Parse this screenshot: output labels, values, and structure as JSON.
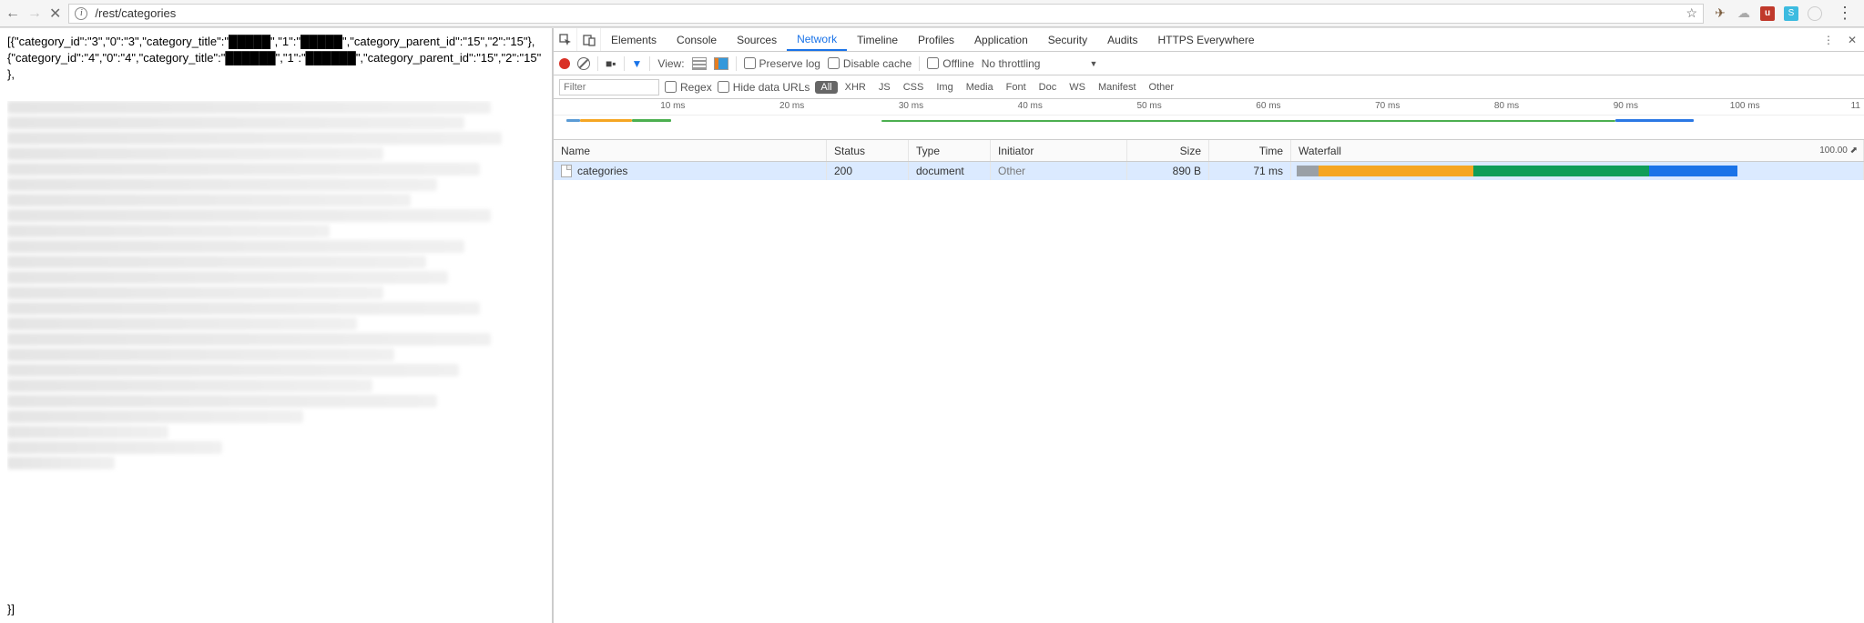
{
  "address_url": "/rest/categories",
  "json_lines": [
    "[{\"category_id\":\"3\",\"0\":\"3\",\"category_title\":\"█████\",\"1\":\"█████\",\"category_parent_id\":\"15\",\"2\":\"15\"},",
    "{\"category_id\":\"4\",\"0\":\"4\",\"category_title\":\"██████\",\"1\":\"██████\",\"category_parent_id\":\"15\",\"2\":\"15\"",
    "},"
  ],
  "json_tail": "}]",
  "devtools_tabs": [
    "Elements",
    "Console",
    "Sources",
    "Network",
    "Timeline",
    "Profiles",
    "Application",
    "Security",
    "Audits",
    "HTTPS Everywhere"
  ],
  "active_tab": "Network",
  "toolbar": {
    "view_label": "View:",
    "preserve_log": "Preserve log",
    "disable_cache": "Disable cache",
    "offline": "Offline",
    "no_throttling": "No throttling"
  },
  "filter_row": {
    "placeholder": "Filter",
    "regex": "Regex",
    "hide_data_urls": "Hide data URLs",
    "types": [
      "All",
      "XHR",
      "JS",
      "CSS",
      "Img",
      "Media",
      "Font",
      "Doc",
      "WS",
      "Manifest",
      "Other"
    ],
    "active_type": "All"
  },
  "timeline_ticks_ms": [
    10,
    20,
    30,
    40,
    50,
    60,
    70,
    80,
    90,
    100
  ],
  "timeline_right_edge": "11",
  "columns": {
    "name": "Name",
    "status": "Status",
    "type": "Type",
    "initiator": "Initiator",
    "size": "Size",
    "time": "Time",
    "waterfall": "Waterfall",
    "waterfall_scale": "100.00 ⬈"
  },
  "requests": [
    {
      "name": "categories",
      "status": "200",
      "type": "document",
      "initiator": "Other",
      "size": "890 B",
      "time": "71 ms"
    }
  ]
}
